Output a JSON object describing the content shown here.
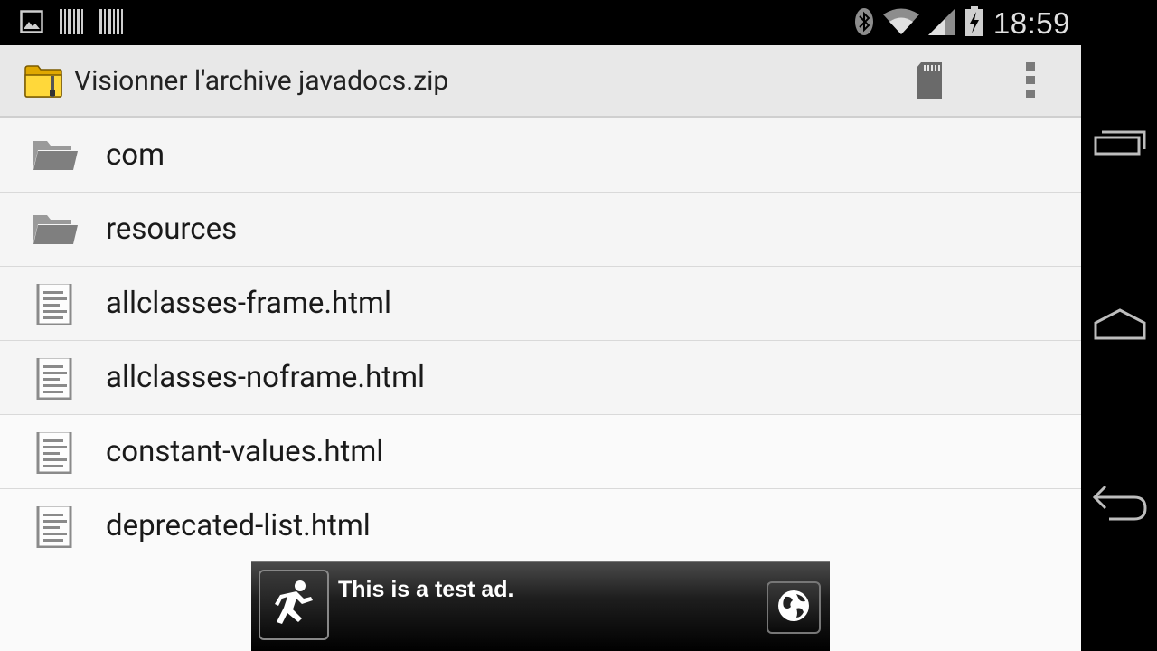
{
  "status_bar": {
    "time": "18:59",
    "left_icons": [
      "image-icon",
      "barcode-icon",
      "barcode-icon"
    ],
    "right_icons": [
      "bluetooth-icon",
      "wifi-icon",
      "signal-icon",
      "battery-charging-icon"
    ]
  },
  "action_bar": {
    "title": "Visionner l'archive javadocs.zip",
    "app_icon": "archive-folder-icon",
    "actions": [
      "sd-card-icon",
      "overflow-menu-icon"
    ]
  },
  "files": [
    {
      "name": "com",
      "type": "folder"
    },
    {
      "name": "resources",
      "type": "folder"
    },
    {
      "name": "allclasses-frame.html",
      "type": "file"
    },
    {
      "name": "allclasses-noframe.html",
      "type": "file"
    },
    {
      "name": "constant-values.html",
      "type": "file"
    },
    {
      "name": "deprecated-list.html",
      "type": "file"
    }
  ],
  "ad": {
    "text": "This is a test ad.",
    "icon": "runner-icon",
    "action_icon": "globe-icon"
  },
  "nav_bar": {
    "buttons": [
      "recents-icon",
      "home-icon",
      "back-icon"
    ]
  },
  "colors": {
    "action_bar_bg": "#e8e8e8",
    "list_bg": "#f5f5f5",
    "divider": "#d9d9d9",
    "status_bar_bg": "#000000",
    "folder_icon": "#8a8a8a",
    "archive_icon": "#f5c518"
  }
}
